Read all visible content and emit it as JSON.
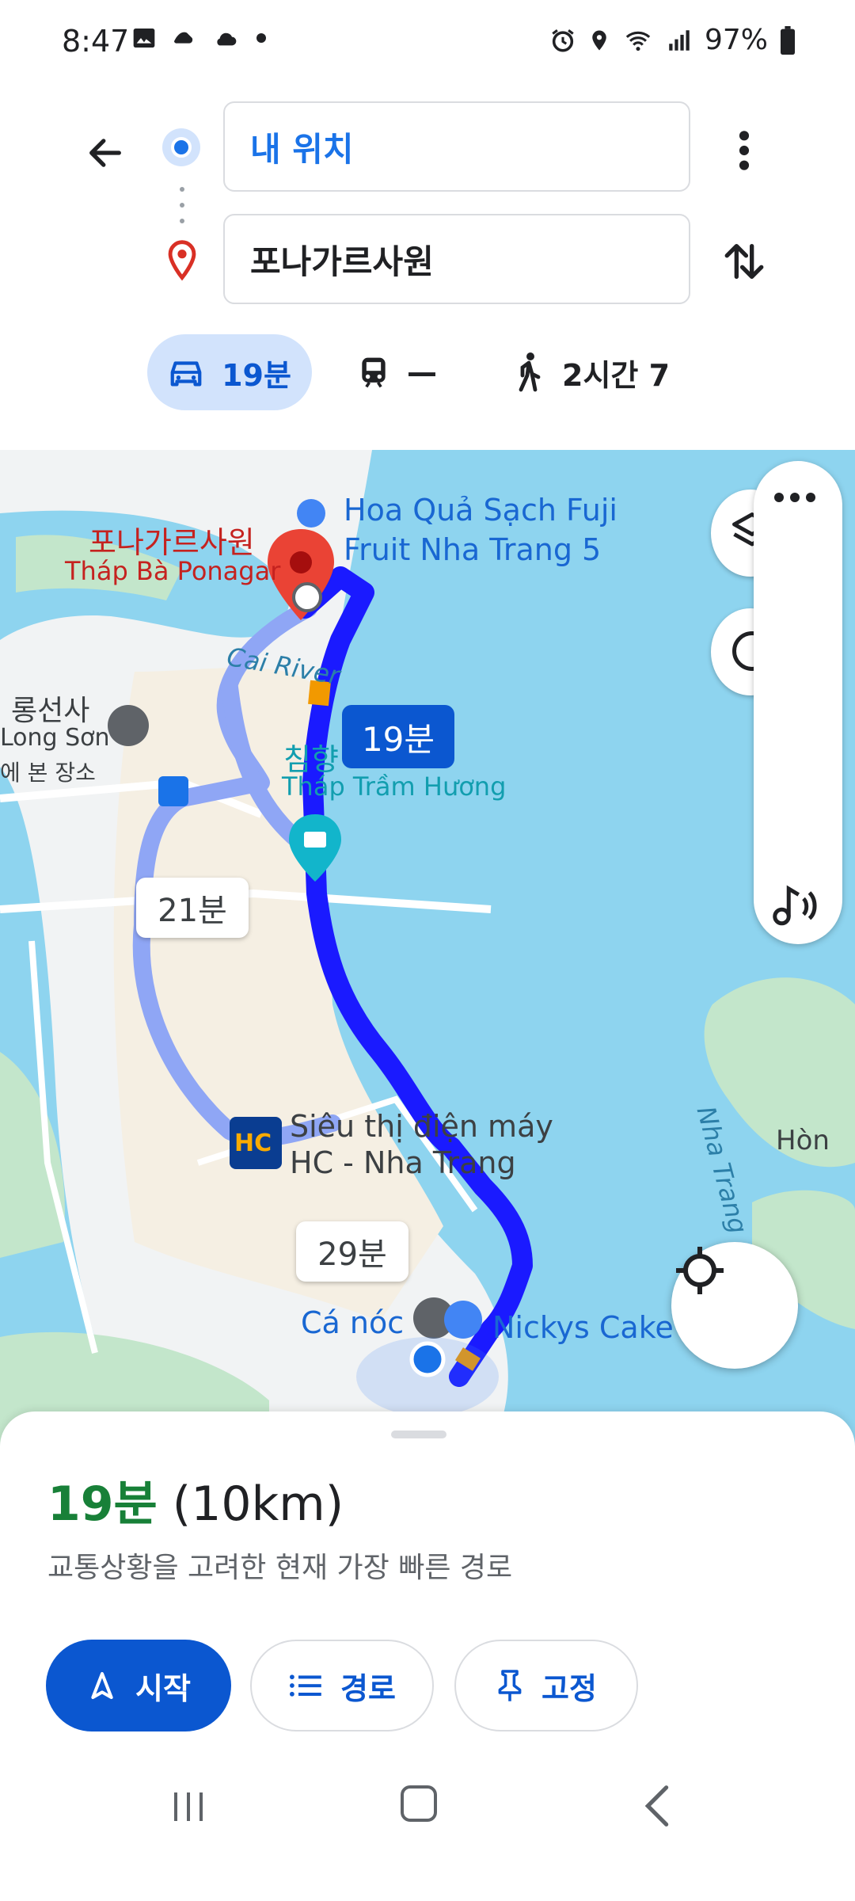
{
  "status_bar": {
    "time": "8:47",
    "battery": "97%"
  },
  "directions": {
    "origin": "내 위치",
    "destination": "포나가르사원"
  },
  "modes": {
    "drive": "19분",
    "transit": "—",
    "walk": "2시간 7"
  },
  "map": {
    "destination_name_ko": "포나가르사원",
    "destination_name_vi": "Tháp Bà Ponagar",
    "poi_fruit_line1": "Hoa Quả Sạch Fuji",
    "poi_fruit_line2": "Fruit Nha Trang 5",
    "river": "Cai River",
    "temple_ko": "롱선사",
    "temple_vi": "Long Sơn",
    "temple_sub": "에 본 장소",
    "tower_ko": "침향",
    "tower_vi": "Tháp Trầm Hương",
    "mall_line1": "Siêu thị điện máy",
    "mall_line2": "HC - Nha Trang",
    "bay": "Nha Trang",
    "island": "Hòn",
    "restaurant": "Cá nóc",
    "cake": "Nickys Cake",
    "route_main_time": "19분",
    "route_alt1_time": "21분",
    "route_alt2_time": "29분",
    "hc_logo": "HC"
  },
  "sheet": {
    "time": "19분",
    "distance": "(10km)",
    "description": "교통상황을 고려한 현재 가장 빠른 경로",
    "start_label": "시작",
    "route_label": "경로",
    "pin_label": "고정"
  },
  "colors": {
    "primary_blue": "#0b57d0",
    "route_blue": "#1a1aff",
    "time_green": "#188038",
    "water": "#8ed4ef",
    "pin_red": "#ea4335"
  },
  "icons": [
    "back-arrow-icon",
    "more-vert-icon",
    "swap-icon",
    "car-icon",
    "train-icon",
    "walk-icon",
    "layers-icon",
    "compass-icon",
    "music-icon",
    "locate-icon",
    "navigate-icon",
    "list-icon",
    "pin-icon"
  ]
}
